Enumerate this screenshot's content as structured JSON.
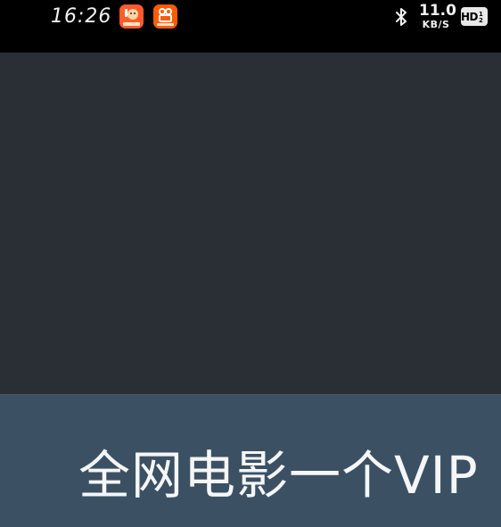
{
  "status_bar": {
    "time": "16:26",
    "notification_icons": [
      "app-notification-icon",
      "kuaishou-notification-icon"
    ],
    "bluetooth_icon": "bluetooth-icon",
    "network_speed_value": "11.0",
    "network_speed_unit": "KB/S",
    "hd_badge": "HD",
    "hd_badge_sub": "1 2"
  },
  "video": {
    "background": "#2a2e35"
  },
  "slide": {
    "heading": "全网电影一个VIP",
    "background": "#3b5063"
  }
}
